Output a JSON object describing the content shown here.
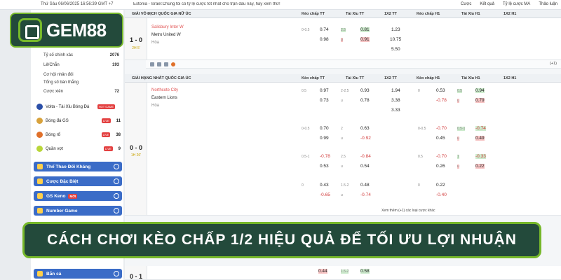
{
  "topbar": {
    "date": "Thứ Sáu 06/06/2025 16:56:39 GMT +7",
    "ticker": "Estonia - Israel:Chúng tôi có tỷ lệ cược tốt nhất cho trận đấu này, hãy xem thử!",
    "buttons": [
      "Cược",
      "Kết quả",
      "Tỷ lệ cược MA",
      "Thảo luận"
    ]
  },
  "logo": {
    "text": "GEM88"
  },
  "sidebar": {
    "stats": [
      {
        "label": "Tỷ số chính xác",
        "count": "2076"
      },
      {
        "label": "Lẻ/Chẵn",
        "count": "193"
      },
      {
        "label": "Cơ hội nhân đôi",
        "count": ""
      },
      {
        "label": "Tổng số bàn thắng",
        "count": ""
      },
      {
        "label": "Cược xiên",
        "count": "72"
      }
    ],
    "sports": [
      {
        "label": "Volta - Tài Xỉu Bóng Đá",
        "badge": "HOT GAME",
        "count": ""
      },
      {
        "label": "Bóng đá GS",
        "badge": "LIVE",
        "count": "11"
      },
      {
        "label": "Bóng rổ",
        "badge": "LIVE",
        "count": "38"
      },
      {
        "label": "Quần vợt",
        "badge": "LIVE",
        "count": "9"
      }
    ],
    "menu": [
      "Thể Thao Đối Kháng",
      "Cược Đặc Biệt",
      "GS Keno",
      "Number Game",
      "Bắn cá"
    ],
    "keno_badge": "MỚI"
  },
  "table": {
    "headers": [
      "Kèo chấp TT",
      "Tài Xỉu TT",
      "1X2 TT",
      "Kèo chấp H1",
      "Tài Xỉu H1",
      "1X2 H1"
    ],
    "league1": "GIẢI VÔ ĐỊCH QUỐC GIA NỮ ÚC",
    "league2": "GIẢI HẠNG NHẤT QUỐC GIA ÚC",
    "match1": {
      "score": "1 - 0",
      "minute": "2H 5'",
      "home": "Salisbury Inter W",
      "away": "Metro United W",
      "draw": "Hòa",
      "r1": [
        "0-0.5",
        "0.74",
        "2.5",
        "0.81",
        "1.23"
      ],
      "r2": [
        "0.98",
        "u",
        "0.91",
        "10.75"
      ],
      "r3": [
        "5.50"
      ]
    },
    "match2": {
      "score": "0 - 0",
      "minute": "1H 26'",
      "home": "Northcote City",
      "away": "Eastern Lions",
      "draw": "Hòa",
      "a1": [
        "0.5",
        "0.97",
        "2-2.5",
        "0.93",
        "1.94",
        "0",
        "0.53",
        "0.5",
        "0.94"
      ],
      "a2": [
        "0.73",
        "u",
        "0.78",
        "3.38",
        "-0.78",
        "u",
        "0.79"
      ],
      "a3": [
        "3.33"
      ],
      "b1": [
        "0-0.5",
        "0.70",
        "2",
        "0.63",
        "0-0.5",
        "-0.70",
        "0.5-1",
        "-0.74"
      ],
      "b2": [
        "0.99",
        "u",
        "-0.92",
        "0.45",
        "u",
        "0.49"
      ],
      "c1": [
        "0.5-1",
        "-0.78",
        "2.5",
        "-0.84",
        "0.5",
        "-0.70",
        "1",
        "-0.33"
      ],
      "c2": [
        "0.53",
        "u",
        "0.54",
        "0.26",
        "u",
        "0.22"
      ],
      "d1": [
        "0",
        "0.43",
        "1.5-2",
        "0.48",
        "0",
        "0.22"
      ],
      "d2": [
        "-0.65",
        "u",
        "-0.74",
        "-0.40"
      ],
      "more": "Xem thêm (+1) các loại cược khác",
      "more_count": "(+1)"
    },
    "match3": {
      "score": "0 - 1",
      "v1": "0.44",
      "line": "1.5-2",
      "v2": "0.58"
    }
  },
  "banner": {
    "text": "CÁCH CHƠI KÈO CHẤP 1/2 HIỆU QUẢ ĐỂ TỐI ƯU LỢI NHUẬN"
  },
  "colors": {
    "brand_dark": "#234a3b",
    "brand_green": "#76b82a",
    "sidebar_blue": "#3b6cc7",
    "odds_red": "#d23b3b",
    "hl_red": "#f7c4c4",
    "hl_green": "#cdebcd"
  }
}
